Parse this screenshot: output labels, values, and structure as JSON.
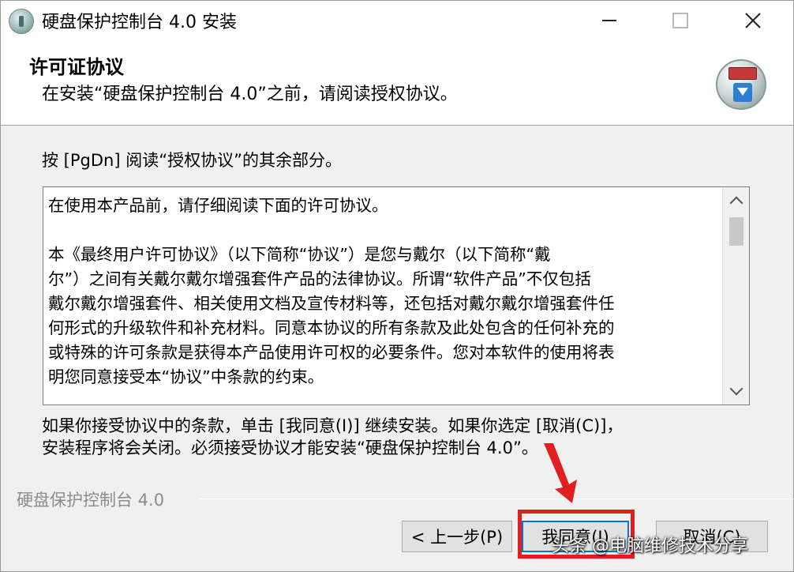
{
  "window": {
    "title": "硬盘保护控制台 4.0 安装",
    "minimize_icon": "minimize-icon",
    "maximize_icon": "maximize-icon",
    "close_icon": "close-icon"
  },
  "header": {
    "title": "许可证协议",
    "subtitle": "在安装“硬盘保护控制台 4.0”之前，请阅读授权协议。"
  },
  "body": {
    "instruction": "按 [PgDn] 阅读“授权协议”的其余部分。",
    "license_text": "在使用本产品前，请仔细阅读下面的许可协议。\n\n本《最终用户许可协议》（以下简称“协议”）是您与戴尔（以下简称“戴\n尔”）之间有关戴尔戴尔增强套件产品的法律协议。所谓“软件产品”不仅包括\n戴尔戴尔增强套件、相关使用文档及宣传材料等，还包括对戴尔戴尔增强套件任\n何形式的升级软件和补充材料。同意本协议的所有条款及此处包含的任何补充的\n或特殊的许可条款是获得本产品使用许可权的必要条件。您对本软件的使用将表\n明您同意接受本“协议”中条款的约束。",
    "accept_text": "如果你接受协议中的条款，单击 [我同意(I)] 继续安装。如果你选定 [取消(C)]，\n安装程序将会关闭。必须接受协议才能安装“硬盘保护控制台 4.0”。"
  },
  "footer": {
    "brand": "硬盘保护控制台 4.0",
    "back_label": "< 上一步(P)",
    "agree_label": "我同意(I)",
    "cancel_label": "取消(C)"
  },
  "annotation": {
    "highlight_color": "#e02020",
    "watermark": "头条 @电脑维修技术分享"
  }
}
